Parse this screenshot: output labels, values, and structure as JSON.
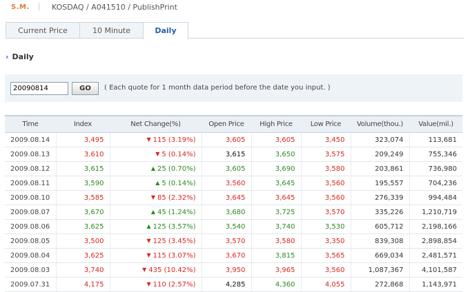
{
  "header": {
    "brand": "S.M.",
    "breadcrumb": "KOSDAQ / A041510 / PublishPrint"
  },
  "tabs": [
    {
      "label": "Current Price",
      "active": false
    },
    {
      "label": "10 Minute",
      "active": false
    },
    {
      "label": "Daily",
      "active": true
    }
  ],
  "section": {
    "title": "Daily",
    "arrow_icon": "chevron-right-icon"
  },
  "search": {
    "date_value": "20090814",
    "go_label": "GO",
    "hint": "( Each quote for 1 month data period before the date you input. )"
  },
  "colors": {
    "up": "#d8261e",
    "down": "#2a8a1f",
    "neutral": "#111111",
    "accent": "#2b5ea8"
  },
  "table": {
    "headers": [
      "Time",
      "Index",
      "Net Change(%)",
      "Open Price",
      "High Price",
      "Low Price",
      "Volume(thou.)",
      "Value(mil.)"
    ],
    "rows": [
      {
        "time": "2009.08.14",
        "index": "3,495",
        "dir": "down",
        "change": "115 (3.19%)",
        "open": "3,605",
        "high": "3,605",
        "low": "3,450",
        "volume": "323,074",
        "value": "113,681",
        "c_open": "red",
        "c_high": "red",
        "c_low": "red"
      },
      {
        "time": "2009.08.13",
        "index": "3,610",
        "dir": "down",
        "change": "5 (0.14%)",
        "open": "3,615",
        "high": "3,650",
        "low": "3,575",
        "volume": "209,249",
        "value": "755,346",
        "c_open": "black",
        "c_high": "green",
        "c_low": "red"
      },
      {
        "time": "2009.08.12",
        "index": "3,615",
        "dir": "up",
        "change": "25 (0.70%)",
        "open": "3,605",
        "high": "3,690",
        "low": "3,580",
        "volume": "203,861",
        "value": "736,980",
        "c_open": "green",
        "c_high": "green",
        "c_low": "red"
      },
      {
        "time": "2009.08.11",
        "index": "3,590",
        "dir": "up",
        "change": "5 (0.14%)",
        "open": "3,560",
        "high": "3,645",
        "low": "3,560",
        "volume": "195,557",
        "value": "704,236",
        "c_open": "red",
        "c_high": "green",
        "c_low": "red"
      },
      {
        "time": "2009.08.10",
        "index": "3,585",
        "dir": "down",
        "change": "85 (2.32%)",
        "open": "3,645",
        "high": "3,645",
        "low": "3,560",
        "volume": "276,339",
        "value": "994,484",
        "c_open": "red",
        "c_high": "red",
        "c_low": "red"
      },
      {
        "time": "2009.08.07",
        "index": "3,670",
        "dir": "up",
        "change": "45 (1.24%)",
        "open": "3,680",
        "high": "3,725",
        "low": "3,570",
        "volume": "335,226",
        "value": "1,210,719",
        "c_open": "green",
        "c_high": "green",
        "c_low": "red"
      },
      {
        "time": "2009.08.06",
        "index": "3,625",
        "dir": "up",
        "change": "125 (3.57%)",
        "open": "3,540",
        "high": "3,740",
        "low": "3,530",
        "volume": "605,712",
        "value": "2,198,166",
        "c_open": "green",
        "c_high": "green",
        "c_low": "green"
      },
      {
        "time": "2009.08.05",
        "index": "3,500",
        "dir": "down",
        "change": "125 (3.45%)",
        "open": "3,570",
        "high": "3,580",
        "low": "3,350",
        "volume": "839,308",
        "value": "2,898,854",
        "c_open": "red",
        "c_high": "red",
        "c_low": "red"
      },
      {
        "time": "2009.08.04",
        "index": "3,625",
        "dir": "down",
        "change": "115 (3.07%)",
        "open": "3,670",
        "high": "3,815",
        "low": "3,565",
        "volume": "669,034",
        "value": "2,481,571",
        "c_open": "red",
        "c_high": "green",
        "c_low": "red"
      },
      {
        "time": "2009.08.03",
        "index": "3,740",
        "dir": "down",
        "change": "435 (10.42%)",
        "open": "3,950",
        "high": "3,965",
        "low": "3,560",
        "volume": "1,087,367",
        "value": "4,101,587",
        "c_open": "red",
        "c_high": "red",
        "c_low": "red"
      },
      {
        "time": "2009.07.31",
        "index": "4,175",
        "dir": "down",
        "change": "110 (2.57%)",
        "open": "4,285",
        "high": "4,360",
        "low": "4,055",
        "volume": "272,868",
        "value": "1,143,971",
        "c_open": "black",
        "c_high": "green",
        "c_low": "red"
      }
    ]
  }
}
